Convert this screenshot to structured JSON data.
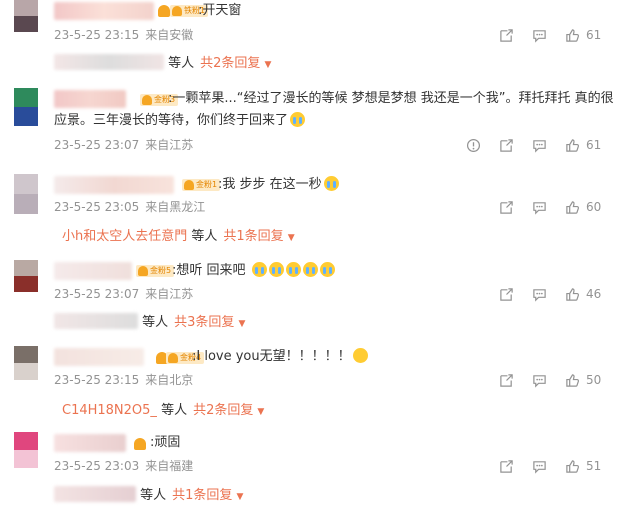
{
  "comments": [
    {
      "badge": "铁粉1",
      "text": ":开天窗",
      "time": "23-5-25 23:15",
      "location": "来自安徽",
      "likes": "61",
      "reply_user": "",
      "reply_suffix": "等人",
      "reply_count": "共2条回复"
    },
    {
      "badge": "金粉3",
      "text": ":一颗苹果...“经过了漫长的等候 梦想是梦想 我还是一个我”。拜托拜托 真的很应景。三年漫长的等待，你们终于回来了",
      "time": "23-5-25 23:07",
      "location": "来自江苏",
      "likes": "61"
    },
    {
      "badge": "金粉1",
      "text": ":我 步步 在这一秒",
      "time": "23-5-25 23:05",
      "location": "来自黑龙江",
      "likes": "60",
      "reply_user": "小h和太空人去任意門",
      "reply_suffix": "等人",
      "reply_count": "共1条回复"
    },
    {
      "badge": "金粉5",
      "text": ":想听 回来吧",
      "time": "23-5-25 23:07",
      "location": "来自江苏",
      "likes": "46",
      "reply_user": "",
      "reply_suffix": "等人",
      "reply_count": "共3条回复"
    },
    {
      "badge": "金粉4",
      "text": ":I love you无望！！！！！",
      "time": "23-5-25 23:15",
      "location": "来自北京",
      "likes": "50",
      "reply_user": "C14H18N2O5_",
      "reply_suffix": "等人",
      "reply_count": "共2条回复"
    },
    {
      "text": ":顽固",
      "time": "23-5-25 23:03",
      "location": "来自福建",
      "likes": "51",
      "reply_user": "",
      "reply_suffix": "等人",
      "reply_count": "共1条回复"
    }
  ]
}
